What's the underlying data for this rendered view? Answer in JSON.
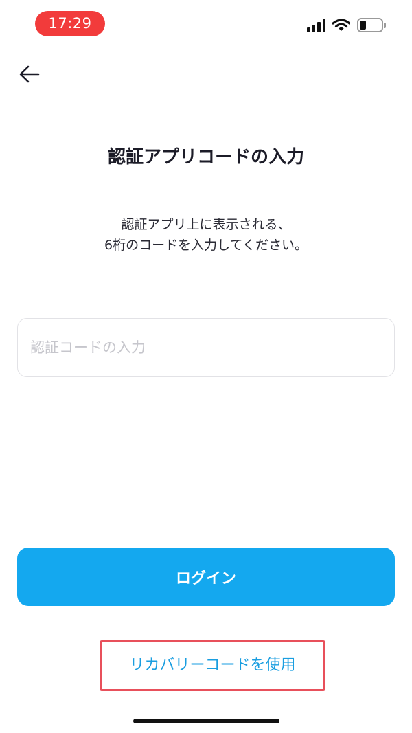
{
  "status_bar": {
    "time": "17:29",
    "time_pill_color": "#f23b3b",
    "battery_level": 0.3
  },
  "header": {
    "back_icon": "arrow-left-icon"
  },
  "page": {
    "title": "認証アプリコードの入力",
    "instruction_line1": "認証アプリ上に表示される、",
    "instruction_line2": "6桁のコードを入力してください。"
  },
  "code_input": {
    "value": "",
    "placeholder": "認証コードの入力"
  },
  "login_button": {
    "label": "ログイン",
    "color": "#14a8ef"
  },
  "recovery_link": {
    "label": "リカバリーコードを使用",
    "highlight_color": "#e8505b"
  }
}
